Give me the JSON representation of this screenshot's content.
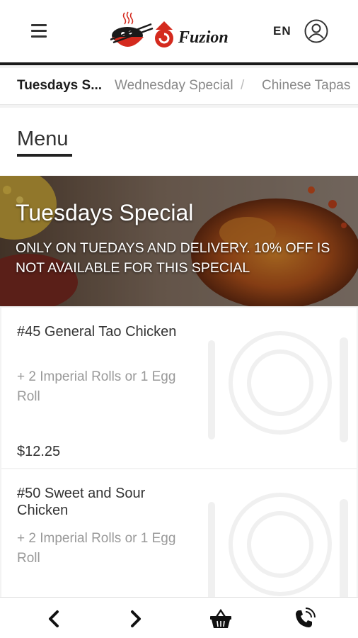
{
  "header": {
    "language": "EN",
    "brand": "Fuzion"
  },
  "tabs": [
    {
      "label": "Tuesdays S...",
      "active": true
    },
    {
      "label": "Wednesday Special",
      "active": false
    },
    {
      "label": "Chinese Tapas",
      "active": false
    }
  ],
  "tab_separator": "/",
  "menu": {
    "title": "Menu"
  },
  "banner": {
    "title": "Tuesdays Special",
    "description": "ONLY ON TUEDAYS AND DELIVERY. 10% OFF IS NOT AVAILABLE FOR THIS SPECIAL"
  },
  "items": [
    {
      "name": "#45 General Tao Chicken",
      "description": "+ 2 Imperial Rolls or 1 Egg Roll",
      "price": "$12.25"
    },
    {
      "name": "#50 Sweet and Sour Chicken",
      "description": "+ 2 Imperial Rolls or 1 Egg Roll",
      "price": ""
    }
  ],
  "colors": {
    "brand_red": "#d42a1e",
    "text_dark": "#222222",
    "text_muted": "#888888"
  },
  "icons": {
    "menu": "hamburger-icon",
    "user": "user-icon",
    "back": "chevron-left-icon",
    "forward": "chevron-right-icon",
    "cart": "basket-icon",
    "call": "phone-icon"
  }
}
